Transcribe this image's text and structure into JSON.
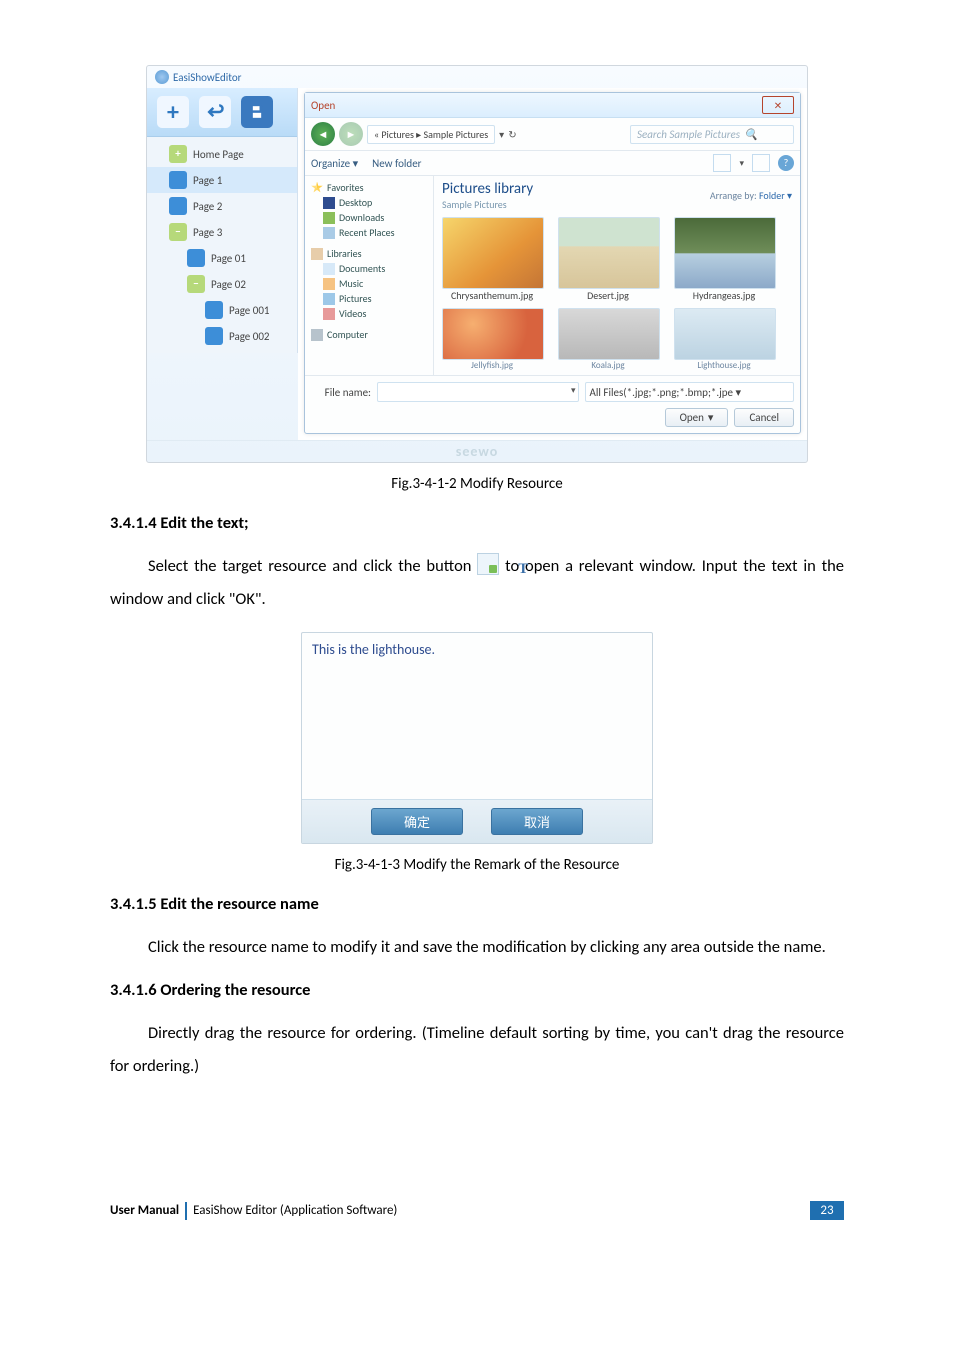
{
  "editor": {
    "window_title": "EasiShowEditor",
    "side": {
      "home": "Home Page",
      "items": [
        {
          "label": "Page 1",
          "lvl": 1,
          "active": true
        },
        {
          "label": "Page 2",
          "lvl": 1
        },
        {
          "label": "Page 3",
          "lvl": 1,
          "plus": true
        },
        {
          "label": "Page 01",
          "lvl": 2
        },
        {
          "label": "Page 02",
          "lvl": 2,
          "plus": true
        },
        {
          "label": "Page 001",
          "lvl": 3
        },
        {
          "label": "Page 002",
          "lvl": 3
        }
      ]
    },
    "open_dialog": {
      "title": "Open",
      "crumb_prefix": "« Pictures ▸",
      "crumb_current": "Sample Pictures",
      "search_placeholder": "Search Sample Pictures",
      "organize": "Organize ▾",
      "new_folder": "New folder",
      "tree": {
        "favorites": "Favorites",
        "desktop": "Desktop",
        "downloads": "Downloads",
        "recent": "Recent Places",
        "libraries": "Libraries",
        "documents": "Documents",
        "music": "Music",
        "pictures": "Pictures",
        "videos": "Videos",
        "computer": "Computer"
      },
      "content": {
        "lib_title": "Pictures library",
        "lib_sub": "Sample Pictures",
        "arrange_lbl": "Arrange by:",
        "arrange_val": "Folder ▾",
        "thumbs": [
          {
            "name": "Chrysanthemum.jpg"
          },
          {
            "name": "Desert.jpg"
          },
          {
            "name": "Hydrangeas.jpg"
          }
        ],
        "thumbs2": [
          {
            "name": "Jellyfish.jpg"
          },
          {
            "name": "Koala.jpg"
          },
          {
            "name": "Lighthouse.jpg"
          }
        ]
      },
      "filename_lbl": "File name:",
      "filter": "All Files(*.jpg;*.png;*.bmp;*.jpe  ▾",
      "open_btn": "Open",
      "open_split": "▾",
      "cancel_btn": "Cancel"
    },
    "footer_logo": "seewo"
  },
  "fig1_caption": "Fig.3-4-1-2 Modify Resource",
  "sec1_heading": "3.4.1.4 Edit the text;",
  "sec1_para_a": "Select the target resource and click the button ",
  "sec1_para_b": " to open a relevant window. Input the text in the window and click \"OK\".",
  "remark": {
    "text": "This is the lighthouse.",
    "ok": "确定",
    "cancel": "取消"
  },
  "fig2_caption": "Fig.3-4-1-3 Modify the Remark of the Resource",
  "sec2_heading": "3.4.1.5 Edit the resource name",
  "sec2_para": "Click the resource name to modify it and save the modification by clicking any area outside the name.",
  "sec3_heading": "3.4.1.6 Ordering the resource",
  "sec3_para": "Directly drag the resource for ordering. (Timeline default sorting by time, you can't drag the resource for ordering.)",
  "footer": {
    "manual": "User Manual",
    "product": "EasiShow Editor (Application Software)",
    "page": "23"
  }
}
